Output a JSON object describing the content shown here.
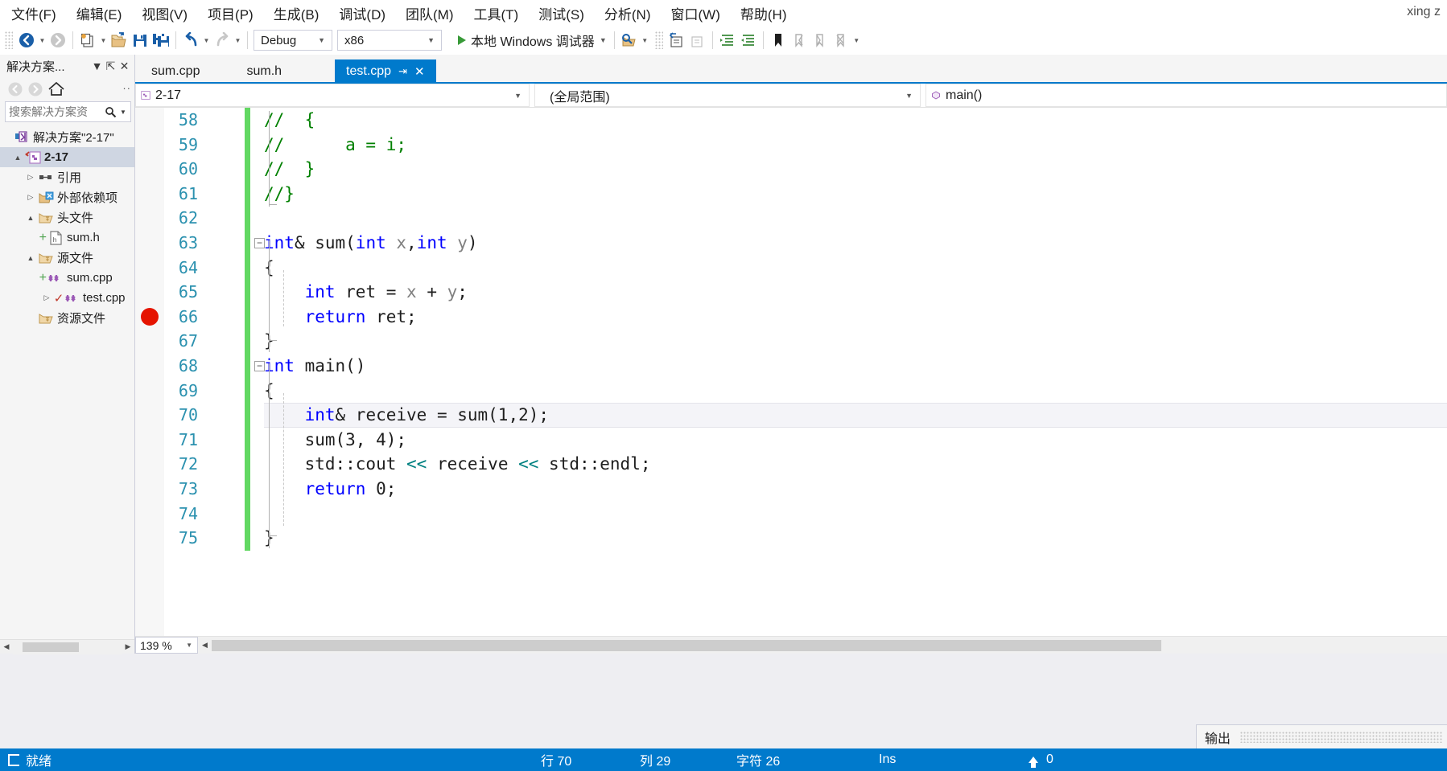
{
  "menu": {
    "items": [
      {
        "label": "文件(F)"
      },
      {
        "label": "编辑(E)"
      },
      {
        "label": "视图(V)"
      },
      {
        "label": "项目(P)"
      },
      {
        "label": "生成(B)"
      },
      {
        "label": "调试(D)"
      },
      {
        "label": "团队(M)"
      },
      {
        "label": "工具(T)"
      },
      {
        "label": "测试(S)"
      },
      {
        "label": "分析(N)"
      },
      {
        "label": "窗口(W)"
      },
      {
        "label": "帮助(H)"
      }
    ],
    "user": "xing z"
  },
  "toolbar": {
    "config": "Debug",
    "platform": "x86",
    "run_label": "本地 Windows 调试器",
    "icons": [
      "navigate-back-icon",
      "navigate-forward-icon",
      "new-item-icon",
      "open-file-icon",
      "save-icon",
      "save-all-icon",
      "undo-icon",
      "redo-icon",
      "find-icon",
      "comment-icon",
      "uncomment-icon",
      "indent-icon",
      "outdent-icon",
      "bookmark-icon",
      "prev-bookmark-icon",
      "next-bookmark-icon",
      "clear-bookmarks-icon"
    ]
  },
  "solution_explorer": {
    "title": "解决方案...",
    "search_placeholder": "搜索解决方案资",
    "tree": [
      {
        "label": "解决方案\"2-17\"",
        "arrow": "",
        "icon": "solution-icon",
        "indent": 4,
        "bold": false,
        "selected": false
      },
      {
        "label": "2-17",
        "arrow": "▲",
        "icon": "project-icon",
        "indent": 18,
        "bold": true,
        "selected": true
      },
      {
        "label": "引用",
        "arrow": "▷",
        "icon": "references-icon",
        "indent": 36,
        "bold": false,
        "selected": false
      },
      {
        "label": "外部依赖项",
        "arrow": "▷",
        "icon": "external-deps-icon",
        "indent": 36,
        "bold": false,
        "selected": false
      },
      {
        "label": "头文件",
        "arrow": "▲",
        "icon": "folder-icon",
        "indent": 36,
        "bold": false,
        "selected": false
      },
      {
        "label": "sum.h",
        "arrow": "",
        "icon": "header-file-icon",
        "indent": 78,
        "bold": false,
        "selected": false
      },
      {
        "label": "源文件",
        "arrow": "▲",
        "icon": "folder-icon",
        "indent": 36,
        "bold": false,
        "selected": false
      },
      {
        "label": "sum.cpp",
        "arrow": "",
        "icon": "cpp-file-icon",
        "indent": 78,
        "bold": false,
        "selected": false
      },
      {
        "label": "test.cpp",
        "arrow": "▷",
        "icon": "cpp-file-icon",
        "indent": 62,
        "bold": false,
        "selected": false
      },
      {
        "label": "资源文件",
        "arrow": "",
        "icon": "folder-icon",
        "indent": 36,
        "bold": false,
        "selected": false
      }
    ]
  },
  "tabs": [
    {
      "label": "sum.cpp",
      "active": false
    },
    {
      "label": "sum.h",
      "active": false
    },
    {
      "label": "test.cpp",
      "active": true,
      "pin": "⇥",
      "close": "✕"
    }
  ],
  "navbar": {
    "project": "2-17",
    "scope": "(全局范围)",
    "member": "main()"
  },
  "editor": {
    "zoom": "139 %",
    "breakpoint_line": 66,
    "current_line": 70,
    "lines": [
      {
        "num": "58",
        "fold": "",
        "changed": true,
        "segments": [
          {
            "t": "//  {",
            "c": "cmt"
          }
        ]
      },
      {
        "num": "59",
        "fold": "",
        "changed": true,
        "segments": [
          {
            "t": "//      a = i;",
            "c": "cmt"
          }
        ]
      },
      {
        "num": "60",
        "fold": "",
        "changed": true,
        "segments": [
          {
            "t": "//  }",
            "c": "cmt"
          }
        ]
      },
      {
        "num": "61",
        "fold": "",
        "changed": true,
        "segments": [
          {
            "t": "//}",
            "c": "cmt"
          }
        ]
      },
      {
        "num": "62",
        "fold": "",
        "changed": true,
        "segments": []
      },
      {
        "num": "63",
        "fold": "−",
        "changed": true,
        "segments": [
          {
            "t": "int",
            "c": "kw"
          },
          {
            "t": "& sum(",
            "c": ""
          },
          {
            "t": "int",
            "c": "kw"
          },
          {
            "t": " x",
            "c": "par"
          },
          {
            "t": ",",
            "c": ""
          },
          {
            "t": "int",
            "c": "kw"
          },
          {
            "t": " y",
            "c": "par"
          },
          {
            "t": ")",
            "c": ""
          }
        ]
      },
      {
        "num": "64",
        "fold": "",
        "changed": true,
        "segments": [
          {
            "t": "{",
            "c": ""
          }
        ]
      },
      {
        "num": "65",
        "fold": "",
        "changed": true,
        "segments": [
          {
            "t": "    ",
            "c": ""
          },
          {
            "t": "int",
            "c": "kw"
          },
          {
            "t": " ret = ",
            "c": ""
          },
          {
            "t": "x",
            "c": "par"
          },
          {
            "t": " + ",
            "c": ""
          },
          {
            "t": "y",
            "c": "par"
          },
          {
            "t": ";",
            "c": ""
          }
        ]
      },
      {
        "num": "66",
        "fold": "",
        "changed": true,
        "segments": [
          {
            "t": "    ",
            "c": ""
          },
          {
            "t": "return",
            "c": "kw"
          },
          {
            "t": " ret;",
            "c": ""
          }
        ]
      },
      {
        "num": "67",
        "fold": "",
        "changed": true,
        "segments": [
          {
            "t": "}",
            "c": ""
          }
        ]
      },
      {
        "num": "68",
        "fold": "−",
        "changed": true,
        "segments": [
          {
            "t": "int",
            "c": "kw"
          },
          {
            "t": " main()",
            "c": ""
          }
        ]
      },
      {
        "num": "69",
        "fold": "",
        "changed": true,
        "segments": [
          {
            "t": "{",
            "c": ""
          }
        ]
      },
      {
        "num": "70",
        "fold": "",
        "changed": true,
        "segments": [
          {
            "t": "    ",
            "c": ""
          },
          {
            "t": "int",
            "c": "kw"
          },
          {
            "t": "& receive = sum(1,2);",
            "c": ""
          }
        ]
      },
      {
        "num": "71",
        "fold": "",
        "changed": true,
        "segments": [
          {
            "t": "    sum(3, 4);",
            "c": ""
          }
        ]
      },
      {
        "num": "72",
        "fold": "",
        "changed": true,
        "segments": [
          {
            "t": "    std::cout ",
            "c": ""
          },
          {
            "t": "<<",
            "c": "op"
          },
          {
            "t": " receive ",
            "c": ""
          },
          {
            "t": "<<",
            "c": "op"
          },
          {
            "t": " std::endl;",
            "c": ""
          }
        ]
      },
      {
        "num": "73",
        "fold": "",
        "changed": true,
        "segments": [
          {
            "t": "    ",
            "c": ""
          },
          {
            "t": "return",
            "c": "kw"
          },
          {
            "t": " 0;",
            "c": ""
          }
        ]
      },
      {
        "num": "74",
        "fold": "",
        "changed": true,
        "segments": []
      },
      {
        "num": "75",
        "fold": "",
        "changed": true,
        "segments": [
          {
            "t": "}",
            "c": ""
          }
        ]
      }
    ]
  },
  "output_panel": {
    "title": "输出"
  },
  "statusbar": {
    "ready": "就绪",
    "line": "行 70",
    "column": "列 29",
    "char": "字符 26",
    "insert": "Ins",
    "pending": "0"
  },
  "colors": {
    "accent": "#007acc",
    "breakpoint": "#e51400",
    "change_bar": "#62d862",
    "keyword": "#0000ff",
    "comment": "#008000",
    "linenumber": "#2b91af"
  }
}
